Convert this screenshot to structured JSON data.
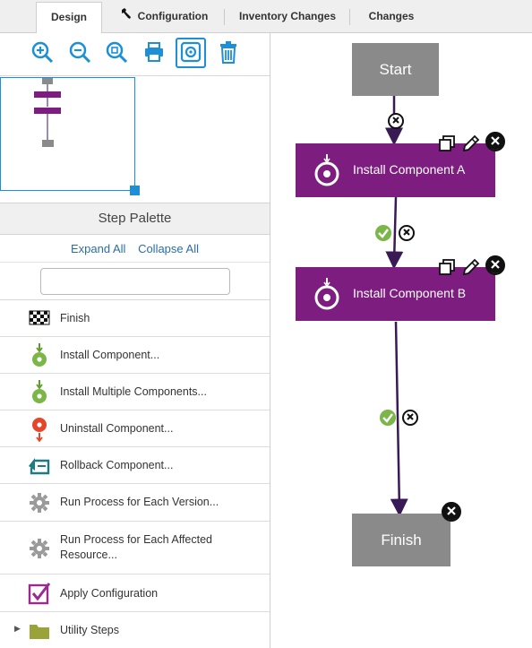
{
  "tabs": [
    {
      "label": "Design"
    },
    {
      "label": "Configuration"
    },
    {
      "label": "Inventory Changes"
    },
    {
      "label": "Changes"
    }
  ],
  "toolbar": {
    "buttons": [
      {
        "icon": "zoom-in-icon"
      },
      {
        "icon": "zoom-out-icon"
      },
      {
        "icon": "zoom-reset-icon"
      },
      {
        "icon": "print-icon"
      },
      {
        "icon": "fit-view-icon",
        "selected": true
      },
      {
        "icon": "trash-icon"
      }
    ],
    "accent": "#1c8fd6"
  },
  "palette": {
    "title": "Step Palette",
    "expand_all": "Expand All",
    "collapse_all": "Collapse All",
    "search_placeholder": "",
    "items": [
      {
        "label": "Finish",
        "icon": "checkered-flag-icon"
      },
      {
        "label": "Install Component...",
        "icon": "install-component-icon"
      },
      {
        "label": "Install Multiple Components...",
        "icon": "install-multiple-icon"
      },
      {
        "label": "Uninstall Component...",
        "icon": "uninstall-component-icon"
      },
      {
        "label": "Rollback Component...",
        "icon": "rollback-icon"
      },
      {
        "label": "Run Process for Each Version...",
        "icon": "gear-icon"
      },
      {
        "label": "Run Process for Each Affected Resource...",
        "icon": "gear-icon"
      },
      {
        "label": "Apply Configuration",
        "icon": "checkbox-icon"
      },
      {
        "label": "Utility Steps",
        "icon": "folder-icon"
      }
    ]
  },
  "canvas": {
    "nodes": [
      {
        "label": "Start"
      },
      {
        "label": "Install Component A"
      },
      {
        "label": "Install Component B"
      },
      {
        "label": "Finish"
      }
    ],
    "colors": {
      "step": "#7d1d7f",
      "terminal": "#8a8a8a",
      "edge": "#3a1a55",
      "success": "#7ab648"
    }
  }
}
